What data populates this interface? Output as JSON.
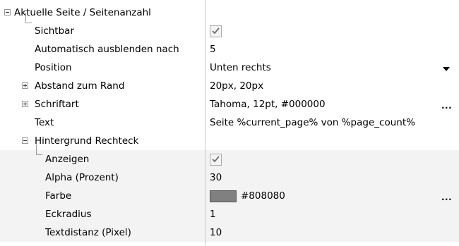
{
  "properties": {
    "section_title": "Aktuelle Seite / Seitenanzahl",
    "visible": {
      "label": "Sichtbar",
      "checked": true
    },
    "auto_hide": {
      "label": "Automatisch ausblenden nach",
      "value": "5"
    },
    "position": {
      "label": "Position",
      "value": "Unten rechts"
    },
    "margin": {
      "label": "Abstand zum Rand",
      "value": "20px, 20px"
    },
    "font": {
      "label": "Schriftart",
      "value": "Tahoma, 12pt, #000000",
      "action": "..."
    },
    "text": {
      "label": "Text",
      "value": "Seite %current_page% von %page_count%"
    },
    "background": {
      "label": "Hintergrund Rechteck",
      "show": {
        "label": "Anzeigen",
        "checked": true
      },
      "alpha": {
        "label": "Alpha (Prozent)",
        "value": "30"
      },
      "color": {
        "label": "Farbe",
        "value": "#808080",
        "swatch": "#808080",
        "action": "..."
      },
      "corner_radius": {
        "label": "Eckradius",
        "value": "1"
      },
      "text_distance": {
        "label": "Textdistanz (Pixel)",
        "value": "10"
      }
    }
  }
}
